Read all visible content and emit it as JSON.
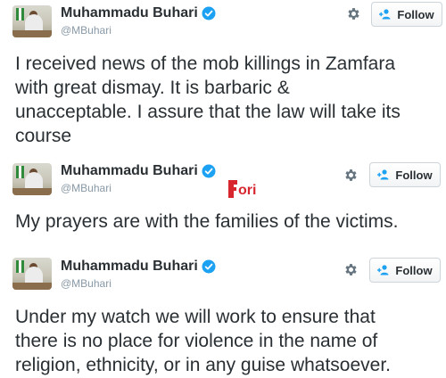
{
  "tweets": [
    {
      "name": "Muhammadu Buhari",
      "handle": "@MBuhari",
      "follow_label": "Follow",
      "lines": [
        "I received news of the mob killings in Zamfara",
        "with great dismay. It is barbaric &",
        "unacceptable. I assure that the law will take its",
        "course"
      ]
    },
    {
      "name": "Muhammadu Buhari",
      "handle": "@MBuhari",
      "follow_label": "Follow",
      "lines": [
        "My prayers are with the families of the victims."
      ]
    },
    {
      "name": "Muhammadu Buhari",
      "handle": "@MBuhari",
      "follow_label": "Follow",
      "lines": [
        "Under my watch we will work to ensure that",
        "there is no place for violence in the name of",
        "religion, ethnicity, or in any guise whatsoever."
      ]
    }
  ],
  "watermark": {
    "text": "ori",
    "color": "#d7262e"
  },
  "icons": {
    "verified": "verified-badge-icon",
    "settings": "gear-icon",
    "follow": "person-add-icon"
  },
  "colors": {
    "text": "#292f33",
    "handle": "#8899a6",
    "verified": "#1da1f2",
    "follow_icon": "#1da1f2",
    "gear": "#66757f"
  }
}
